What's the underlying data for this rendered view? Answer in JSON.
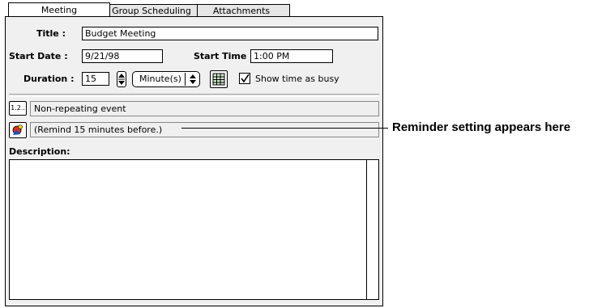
{
  "tabs": [
    {
      "label": "Meeting"
    },
    {
      "label": "Group Scheduling"
    },
    {
      "label": "Attachments"
    }
  ],
  "form": {
    "title_label": "Title",
    "title_value": "Budget Meeting",
    "start_date_label": "Start Date",
    "start_date_value": "9/21/98",
    "start_time_label": "Start Time",
    "start_time_value": "1:00 PM",
    "duration_label": "Duration",
    "duration_value": "15",
    "duration_unit": "Minute(s)",
    "busy_label": "Show time as busy",
    "busy_checked": true,
    "repeat_button": "1.2..",
    "repeat_text": "Non-repeating event",
    "reminder_text": "(Remind 15 minutes before.)",
    "description_label": "Description",
    "description_value": ""
  },
  "callout": {
    "text": "Reminder setting appears here"
  }
}
